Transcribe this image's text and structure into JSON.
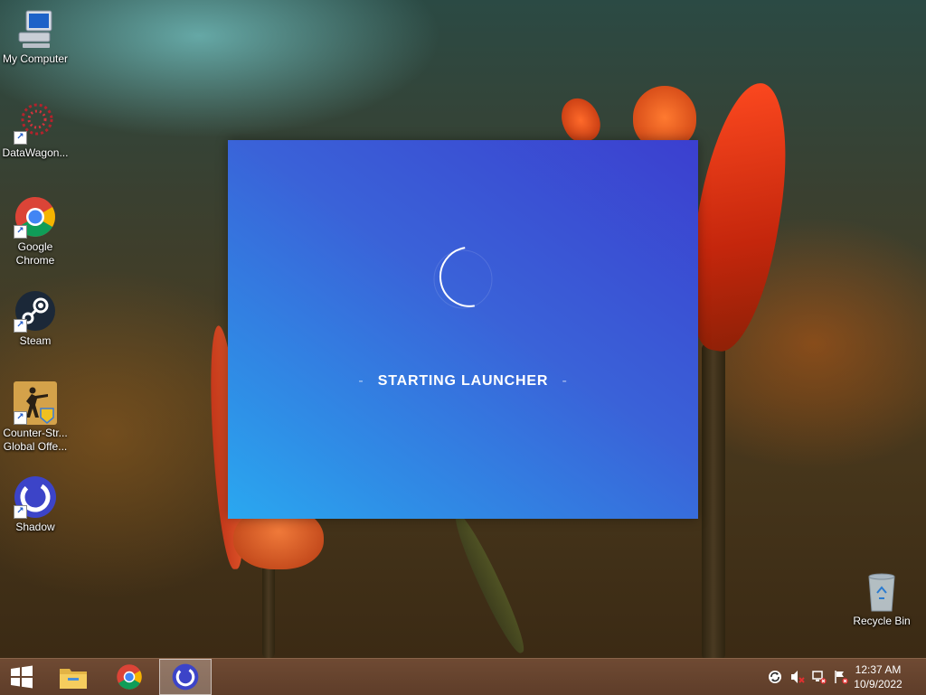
{
  "desktop": {
    "icons": [
      {
        "label": "My Computer",
        "icon": "computer-icon"
      },
      {
        "label": "DataWagon...",
        "icon": "datawagon-icon"
      },
      {
        "label": "Google Chrome",
        "icon": "chrome-icon"
      },
      {
        "label": "Steam",
        "icon": "steam-icon"
      },
      {
        "label": "Counter-Str... Global Offe...",
        "icon": "csgo-icon"
      },
      {
        "label": "Shadow",
        "icon": "shadow-icon"
      }
    ],
    "recycle_bin": {
      "label": "Recycle Bin",
      "icon": "recycle-bin-icon"
    }
  },
  "launcher": {
    "status_text": "STARTING LAUNCHER",
    "dash": "-",
    "colors": {
      "top": "#3b3fcf",
      "bottom": "#2aa8f0"
    }
  },
  "taskbar": {
    "start": {
      "icon": "windows-start-icon"
    },
    "pinned": [
      {
        "name": "File Explorer",
        "icon": "folder-icon"
      },
      {
        "name": "Google Chrome",
        "icon": "chrome-icon"
      },
      {
        "name": "Shadow",
        "icon": "shadow-icon",
        "active": true
      }
    ],
    "tray": [
      "sync-icon",
      "volume-muted-icon",
      "network-disconnected-icon",
      "action-center-flag-icon"
    ],
    "clock": {
      "time": "12:37 AM",
      "date": "10/9/2022"
    }
  }
}
